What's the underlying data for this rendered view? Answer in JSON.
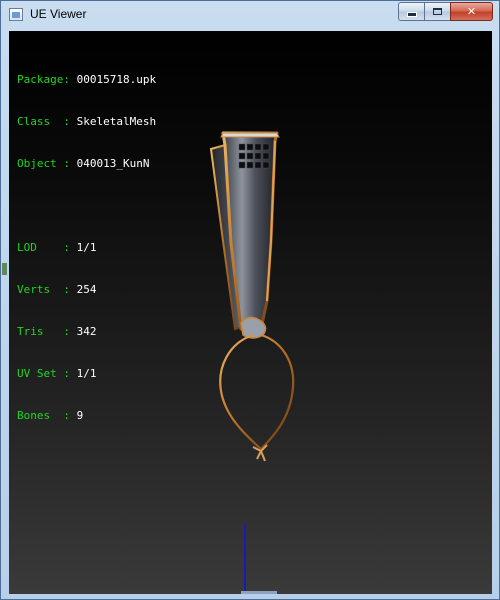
{
  "window": {
    "title": "UE Viewer",
    "minimize_glyph": "minimize-icon",
    "maximize_glyph": "maximize-icon",
    "close_glyph": "✕"
  },
  "info": {
    "package": {
      "key": "Package: ",
      "value": "00015718.upk"
    },
    "class": {
      "key": "Class  : ",
      "value": "SkeletalMesh"
    },
    "object": {
      "key": "Object : ",
      "value": "040013_KunN"
    },
    "lod": {
      "key": "LOD    : ",
      "value": "1/1"
    },
    "verts": {
      "key": "Verts  : ",
      "value": "254"
    },
    "tris": {
      "key": "Tris   : ",
      "value": "342"
    },
    "uvset": {
      "key": "UV Set : ",
      "value": "1/1"
    },
    "bones": {
      "key": "Bones  : ",
      "value": "9"
    }
  },
  "colors": {
    "label_green": "#22d422",
    "value_white": "#ffffff",
    "axis_blue": "#1a1ab8",
    "mesh_gold": "#c8873a"
  }
}
